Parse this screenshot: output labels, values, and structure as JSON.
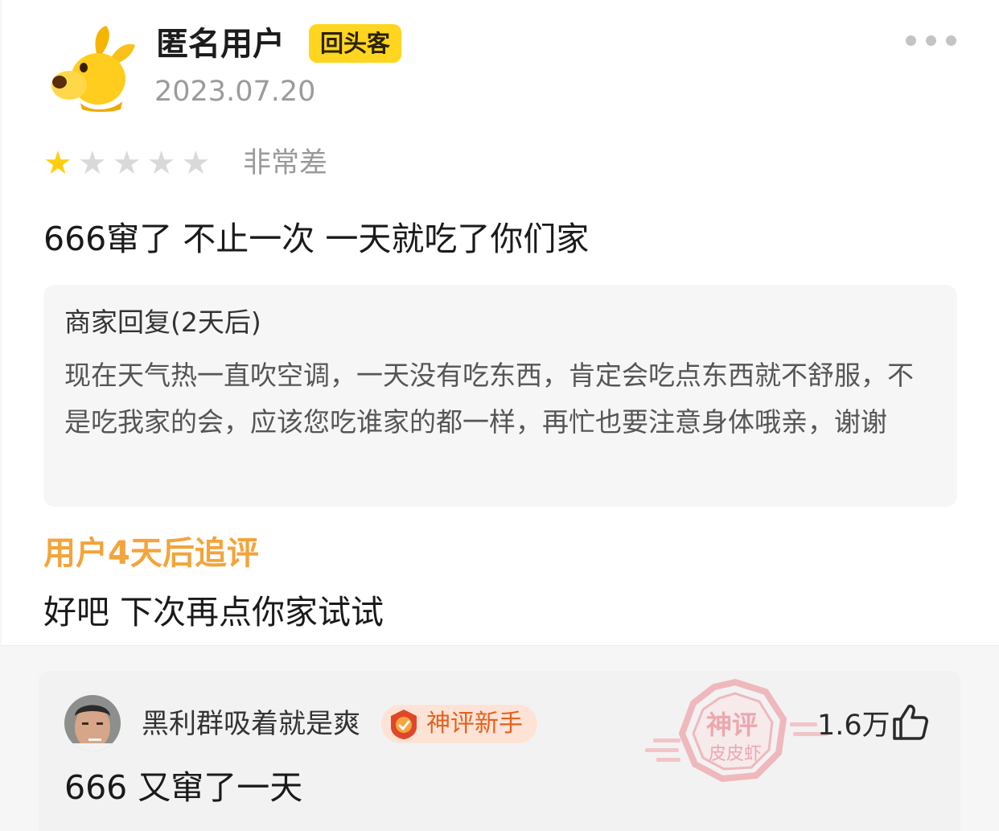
{
  "review": {
    "username": "匿名用户",
    "badge": "回头客",
    "date": "2023.07.20",
    "rating": {
      "value": 1,
      "max": 5,
      "label": "非常差"
    },
    "text": "666窜了 不止一次 一天就吃了你们家",
    "merchant_reply": {
      "title": "商家回复(2天后)",
      "text": "现在天气热一直吹空调，一天没有吃东西，肯定会吃点东西就不舒服，不是吃我家的会，应该您吃谁家的都一样，再忙也要注意身体哦亲，谢谢"
    },
    "followup": {
      "title": "用户4天后追评",
      "text": "好吧 下次再点你家试试"
    }
  },
  "comment": {
    "username": "黑利群吸着就是爽",
    "badge": "神评新手",
    "stamp_top": "神评",
    "stamp_bottom": "皮皮虾",
    "likes": "1.6万",
    "text": "666 又窜了一天"
  },
  "colors": {
    "badge_yellow": "#ffd51f",
    "star_on": "#ffcf0f",
    "star_off": "#d9d9d9",
    "followup_orange": "#f3a43b",
    "comment_badge_bg": "#fde3d6",
    "comment_badge_text": "#e4611f"
  },
  "icons": [
    "dog-avatar-icon",
    "more-icon",
    "star-icon",
    "user-avatar",
    "medal-icon",
    "thumbs-up-icon"
  ]
}
